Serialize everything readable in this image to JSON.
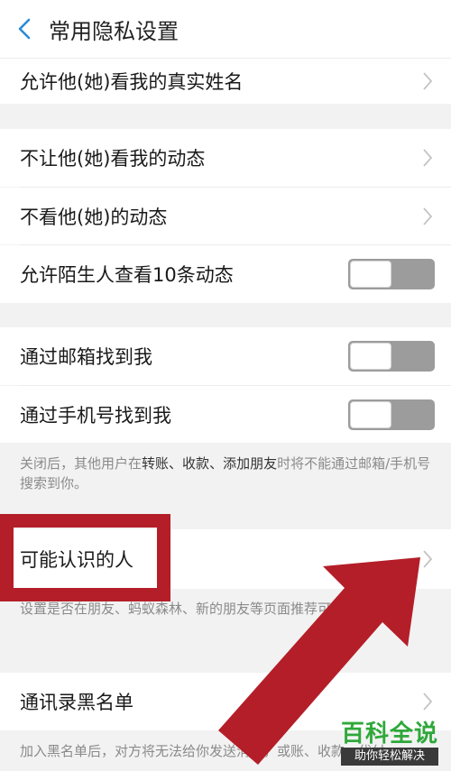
{
  "header": {
    "title": "常用隐私设置"
  },
  "rows": {
    "real_name": "允许他(她)看我的真实姓名",
    "hide_my_moments": "不让他(她)看我的动态",
    "hide_their_moments": "不看他(她)的动态",
    "stranger_view": "允许陌生人查看10条动态",
    "find_by_email": "通过邮箱找到我",
    "find_by_phone": "通过手机号找到我",
    "people_you_may_know": "可能认识的人",
    "contact_blacklist": "通讯录黑名单"
  },
  "notes": {
    "find_prefix": "关闭后，其他用户在",
    "find_transfer": "转账",
    "find_sep1": "、",
    "find_collect": "收款",
    "find_sep2": "、",
    "find_add_friend": "添加朋友",
    "find_suffix": "时将不能通过邮箱/手机号搜索到你。",
    "pymk": "设置是否在朋友、蚂蚁森林、新的朋友等页面推荐可能认识的人",
    "blacklist": "加入黑名单后，对方将无法给你发送消息，或账、收款、代付"
  },
  "toggles": {
    "stranger_view": false,
    "find_by_email": false,
    "find_by_phone": false
  },
  "watermark": {
    "title": "百科全说",
    "subtitle": "助你轻松解决"
  },
  "colors": {
    "annotation_red": "#b41e28",
    "toggle_off": "#9c9c9c",
    "watermark_green": "#2fa83a"
  }
}
